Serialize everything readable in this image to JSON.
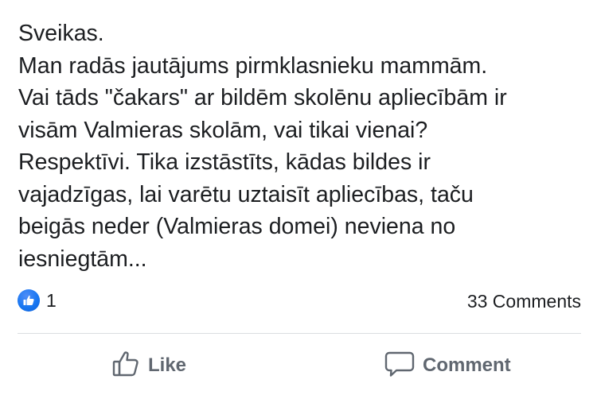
{
  "post": {
    "lines": [
      "Sveikas.",
      "Man radās jautājums pirmklasnieku mammām.",
      "Vai tāds \"čakars\" ar bildēm skolēnu apliecībām ir",
      "visām Valmieras skolām, vai tikai vienai?",
      "Respektīvi. Tika izstāstīts, kādas bildes ir",
      "vajadzīgas, lai varētu uztaisīt apliecības, taču",
      "beigās neder (Valmieras domei) neviena no",
      "iesniegtām..."
    ]
  },
  "stats": {
    "reaction_icon": "like-icon",
    "reaction_count": "1",
    "comments_label": "33 Comments"
  },
  "actions": {
    "like_label": "Like",
    "like_icon": "thumbs-up-outline-icon",
    "comment_label": "Comment",
    "comment_icon": "speech-bubble-icon"
  },
  "colors": {
    "text": "#1c1e21",
    "secondary_text": "#606770",
    "like_blue": "#1877f2",
    "divider": "#dadde1"
  }
}
